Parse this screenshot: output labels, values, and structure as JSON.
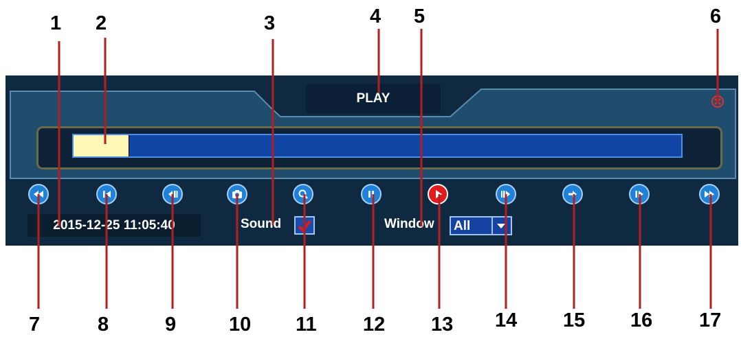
{
  "callouts": {
    "top": [
      "1",
      "2",
      "3",
      "4",
      "5",
      "6"
    ],
    "bottom": [
      "7",
      "8",
      "9",
      "10",
      "11",
      "12",
      "13",
      "14",
      "15",
      "16",
      "17"
    ]
  },
  "window": {
    "title": "PLAY",
    "close_icon": "close-circle-icon"
  },
  "timeline": {
    "progress_percent": 9
  },
  "controls": [
    {
      "name": "fast-rewind-icon"
    },
    {
      "name": "slow-rewind-icon"
    },
    {
      "name": "step-back-icon"
    },
    {
      "name": "camera-icon"
    },
    {
      "name": "zoom-icon"
    },
    {
      "name": "pause-icon"
    },
    {
      "name": "play-icon"
    },
    {
      "name": "step-forward-icon"
    },
    {
      "name": "skip-forward-icon"
    },
    {
      "name": "slow-forward-icon"
    },
    {
      "name": "fast-forward-icon"
    }
  ],
  "status": {
    "datetime": "2015-12-25 11:05:40",
    "sound_label": "Sound",
    "sound_checked": true,
    "window_label": "Window",
    "window_value": "All"
  },
  "colors": {
    "panel_bg": "#0f2a40",
    "timeline_bar": "#1145a5",
    "timeline_fill": "#fff8b6",
    "button_blue": "#1f82d8",
    "play_red": "#df1d1d",
    "callout_red": "#b51e1e"
  }
}
